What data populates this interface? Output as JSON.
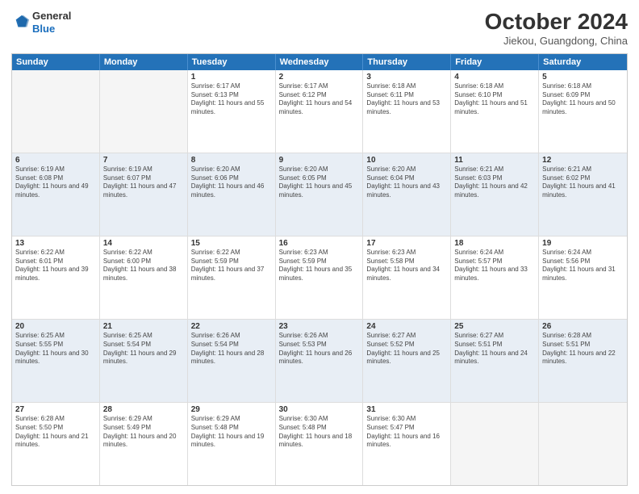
{
  "logo": {
    "general": "General",
    "blue": "Blue"
  },
  "header": {
    "month": "October 2024",
    "location": "Jiekou, Guangdong, China"
  },
  "weekdays": [
    "Sunday",
    "Monday",
    "Tuesday",
    "Wednesday",
    "Thursday",
    "Friday",
    "Saturday"
  ],
  "weeks": [
    [
      {
        "day": "",
        "info": ""
      },
      {
        "day": "",
        "info": ""
      },
      {
        "day": "1",
        "info": "Sunrise: 6:17 AM\nSunset: 6:13 PM\nDaylight: 11 hours and 55 minutes."
      },
      {
        "day": "2",
        "info": "Sunrise: 6:17 AM\nSunset: 6:12 PM\nDaylight: 11 hours and 54 minutes."
      },
      {
        "day": "3",
        "info": "Sunrise: 6:18 AM\nSunset: 6:11 PM\nDaylight: 11 hours and 53 minutes."
      },
      {
        "day": "4",
        "info": "Sunrise: 6:18 AM\nSunset: 6:10 PM\nDaylight: 11 hours and 51 minutes."
      },
      {
        "day": "5",
        "info": "Sunrise: 6:18 AM\nSunset: 6:09 PM\nDaylight: 11 hours and 50 minutes."
      }
    ],
    [
      {
        "day": "6",
        "info": "Sunrise: 6:19 AM\nSunset: 6:08 PM\nDaylight: 11 hours and 49 minutes."
      },
      {
        "day": "7",
        "info": "Sunrise: 6:19 AM\nSunset: 6:07 PM\nDaylight: 11 hours and 47 minutes."
      },
      {
        "day": "8",
        "info": "Sunrise: 6:20 AM\nSunset: 6:06 PM\nDaylight: 11 hours and 46 minutes."
      },
      {
        "day": "9",
        "info": "Sunrise: 6:20 AM\nSunset: 6:05 PM\nDaylight: 11 hours and 45 minutes."
      },
      {
        "day": "10",
        "info": "Sunrise: 6:20 AM\nSunset: 6:04 PM\nDaylight: 11 hours and 43 minutes."
      },
      {
        "day": "11",
        "info": "Sunrise: 6:21 AM\nSunset: 6:03 PM\nDaylight: 11 hours and 42 minutes."
      },
      {
        "day": "12",
        "info": "Sunrise: 6:21 AM\nSunset: 6:02 PM\nDaylight: 11 hours and 41 minutes."
      }
    ],
    [
      {
        "day": "13",
        "info": "Sunrise: 6:22 AM\nSunset: 6:01 PM\nDaylight: 11 hours and 39 minutes."
      },
      {
        "day": "14",
        "info": "Sunrise: 6:22 AM\nSunset: 6:00 PM\nDaylight: 11 hours and 38 minutes."
      },
      {
        "day": "15",
        "info": "Sunrise: 6:22 AM\nSunset: 5:59 PM\nDaylight: 11 hours and 37 minutes."
      },
      {
        "day": "16",
        "info": "Sunrise: 6:23 AM\nSunset: 5:59 PM\nDaylight: 11 hours and 35 minutes."
      },
      {
        "day": "17",
        "info": "Sunrise: 6:23 AM\nSunset: 5:58 PM\nDaylight: 11 hours and 34 minutes."
      },
      {
        "day": "18",
        "info": "Sunrise: 6:24 AM\nSunset: 5:57 PM\nDaylight: 11 hours and 33 minutes."
      },
      {
        "day": "19",
        "info": "Sunrise: 6:24 AM\nSunset: 5:56 PM\nDaylight: 11 hours and 31 minutes."
      }
    ],
    [
      {
        "day": "20",
        "info": "Sunrise: 6:25 AM\nSunset: 5:55 PM\nDaylight: 11 hours and 30 minutes."
      },
      {
        "day": "21",
        "info": "Sunrise: 6:25 AM\nSunset: 5:54 PM\nDaylight: 11 hours and 29 minutes."
      },
      {
        "day": "22",
        "info": "Sunrise: 6:26 AM\nSunset: 5:54 PM\nDaylight: 11 hours and 28 minutes."
      },
      {
        "day": "23",
        "info": "Sunrise: 6:26 AM\nSunset: 5:53 PM\nDaylight: 11 hours and 26 minutes."
      },
      {
        "day": "24",
        "info": "Sunrise: 6:27 AM\nSunset: 5:52 PM\nDaylight: 11 hours and 25 minutes."
      },
      {
        "day": "25",
        "info": "Sunrise: 6:27 AM\nSunset: 5:51 PM\nDaylight: 11 hours and 24 minutes."
      },
      {
        "day": "26",
        "info": "Sunrise: 6:28 AM\nSunset: 5:51 PM\nDaylight: 11 hours and 22 minutes."
      }
    ],
    [
      {
        "day": "27",
        "info": "Sunrise: 6:28 AM\nSunset: 5:50 PM\nDaylight: 11 hours and 21 minutes."
      },
      {
        "day": "28",
        "info": "Sunrise: 6:29 AM\nSunset: 5:49 PM\nDaylight: 11 hours and 20 minutes."
      },
      {
        "day": "29",
        "info": "Sunrise: 6:29 AM\nSunset: 5:48 PM\nDaylight: 11 hours and 19 minutes."
      },
      {
        "day": "30",
        "info": "Sunrise: 6:30 AM\nSunset: 5:48 PM\nDaylight: 11 hours and 18 minutes."
      },
      {
        "day": "31",
        "info": "Sunrise: 6:30 AM\nSunset: 5:47 PM\nDaylight: 11 hours and 16 minutes."
      },
      {
        "day": "",
        "info": ""
      },
      {
        "day": "",
        "info": ""
      }
    ]
  ]
}
